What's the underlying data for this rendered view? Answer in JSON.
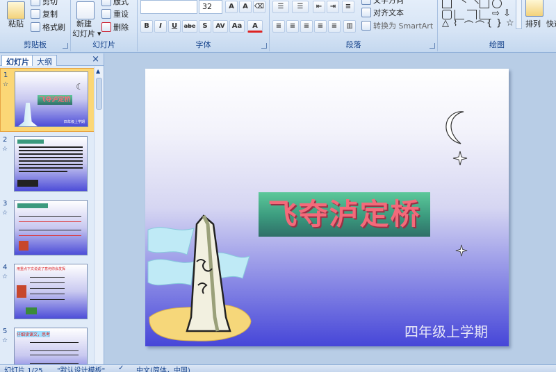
{
  "ribbon": {
    "clipboard": {
      "label": "剪贴板",
      "paste": "粘贴",
      "cut": "剪切",
      "copy": "复制",
      "format_painter": "格式刷"
    },
    "slides": {
      "label": "幻灯片",
      "new_slide_line1": "新建",
      "new_slide_line2": "幻灯片",
      "layout": "版式",
      "reset": "重设",
      "delete": "删除"
    },
    "font": {
      "label": "字体",
      "font_name": "",
      "font_size": "32",
      "bold": "B",
      "italic": "I",
      "underline": "U",
      "strike": "abe",
      "shadow": "S",
      "spacing": "AV",
      "change_case": "Aa",
      "color": "A"
    },
    "paragraph": {
      "label": "段落",
      "text_direction": "文字方向",
      "align_text": "对齐文本",
      "smartart": "转换为 SmartArt"
    },
    "drawing": {
      "label": "绘图",
      "arrange": "排列",
      "quick_styles": "快速"
    }
  },
  "left_pane": {
    "tab_slides": "幻灯片",
    "tab_outline": "大纲",
    "close": "×",
    "thumbnails": [
      {
        "number": "1",
        "title": "飞夺泸定桥",
        "subtitle": "四年级上学期",
        "selected": true
      },
      {
        "number": "2",
        "title": "",
        "selected": false
      },
      {
        "number": "3",
        "title": "",
        "selected": false
      },
      {
        "number": "4",
        "title": "用重点下文说说了意何你会发挥",
        "selected": false
      },
      {
        "number": "5",
        "title": "仔细读课文，思考",
        "selected": false
      }
    ]
  },
  "slide": {
    "title": "飞夺泸定桥",
    "subtitle": "四年级上学期"
  },
  "status": {
    "slide_counter": "幻灯片 1/25",
    "theme": "\"默认设计模板\"",
    "language": "中文(简体，中国)"
  }
}
